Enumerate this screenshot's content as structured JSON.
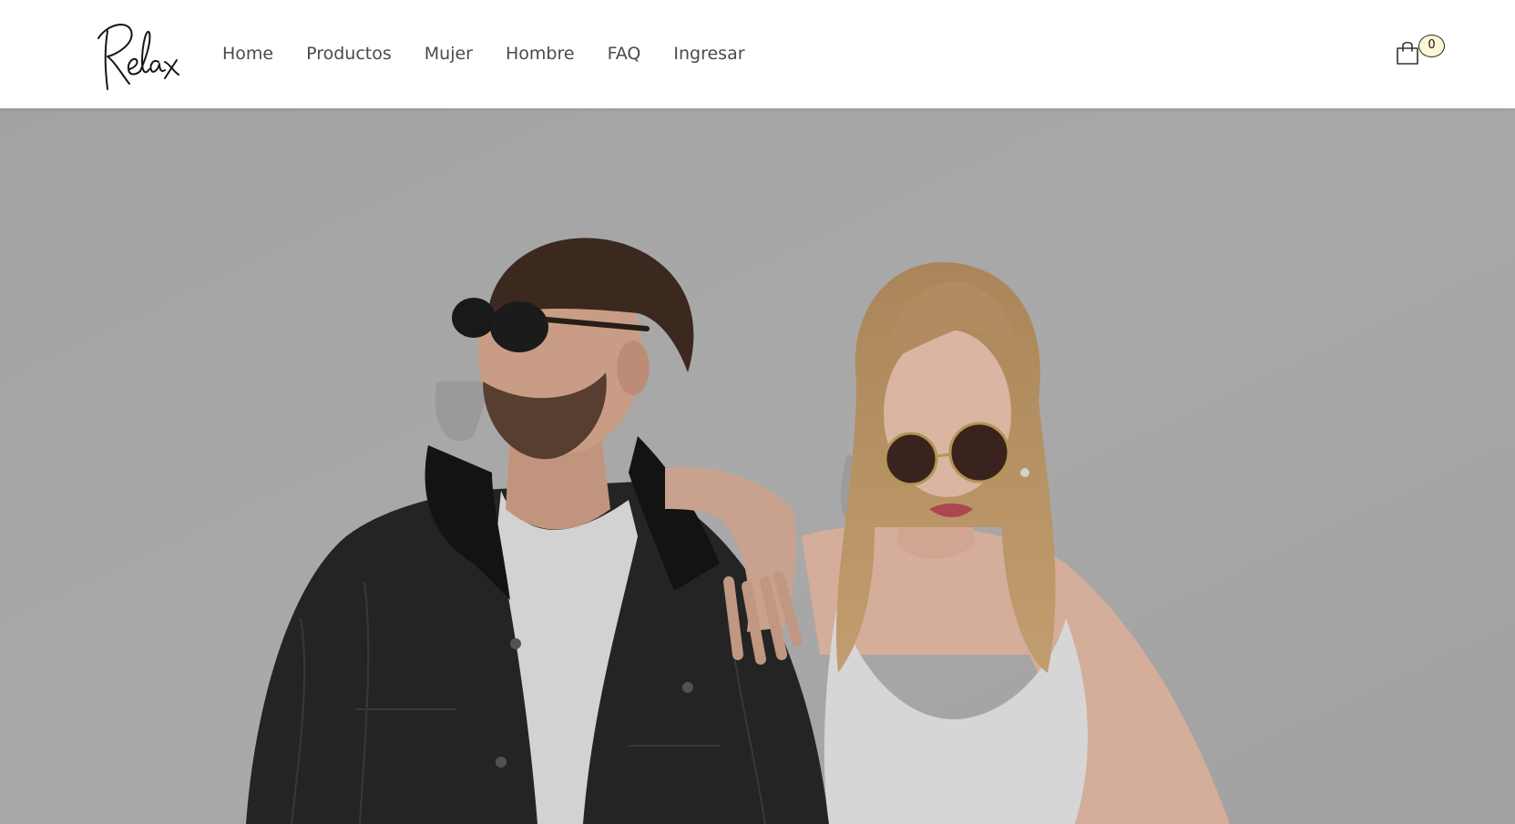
{
  "brand": {
    "logo_text": "Relax",
    "logo_icon": "script-logo"
  },
  "nav": {
    "items": [
      {
        "label": "Home"
      },
      {
        "label": "Productos"
      },
      {
        "label": "Mujer"
      },
      {
        "label": "Hombre"
      },
      {
        "label": "FAQ"
      },
      {
        "label": "Ingresar"
      }
    ]
  },
  "cart": {
    "icon": "shopping-bag-icon",
    "count": "0"
  },
  "hero": {
    "image": "hero-photo-couple-sunglasses"
  },
  "colors": {
    "nav_text": "#4a4a4a",
    "hero_background": "#acacac",
    "badge_background": "#fdf7d6"
  }
}
